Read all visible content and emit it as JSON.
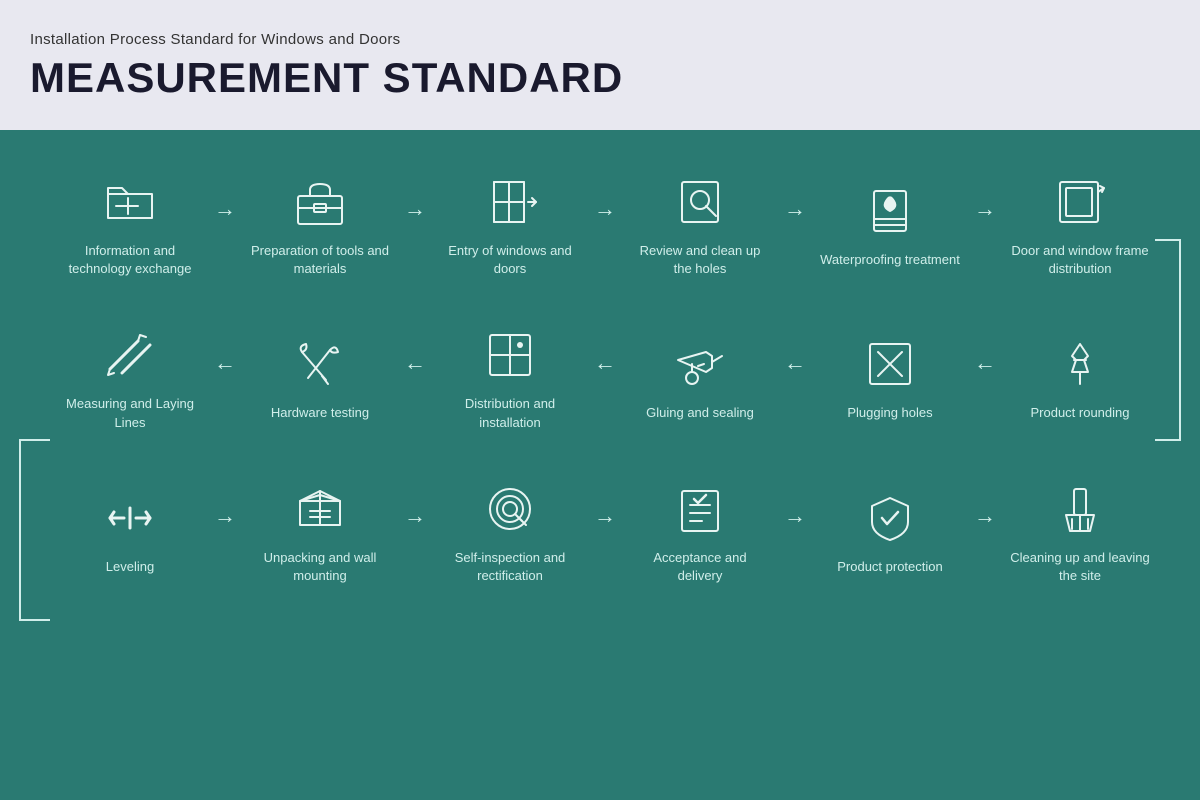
{
  "header": {
    "subtitle": "Installation Process Standard for Windows and Doors",
    "title": "MEASUREMENT STANDARD"
  },
  "colors": {
    "background": "#2a7a72",
    "header_bg": "#e8e8f0",
    "icon_stroke": "#e8f4f2",
    "text": "#d0eeea",
    "title": "#1a1a2e"
  },
  "row1": [
    {
      "id": "info-tech",
      "label": "Information and technology exchange"
    },
    {
      "id": "prep-tools",
      "label": "Preparation of tools and materials"
    },
    {
      "id": "entry-windows",
      "label": "Entry of windows and doors"
    },
    {
      "id": "review-holes",
      "label": "Review and clean up the holes"
    },
    {
      "id": "waterproofing",
      "label": "Waterproofing treatment"
    },
    {
      "id": "frame-dist",
      "label": "Door and window frame distribution"
    }
  ],
  "row2": [
    {
      "id": "measuring",
      "label": "Measuring and Laying Lines"
    },
    {
      "id": "hardware",
      "label": "Hardware testing"
    },
    {
      "id": "distribution",
      "label": "Distribution and installation"
    },
    {
      "id": "gluing",
      "label": "Gluing and sealing"
    },
    {
      "id": "plugging",
      "label": "Plugging holes"
    },
    {
      "id": "product-round",
      "label": "Product rounding"
    }
  ],
  "row3": [
    {
      "id": "leveling",
      "label": "Leveling"
    },
    {
      "id": "unpacking",
      "label": "Unpacking and wall mounting"
    },
    {
      "id": "self-inspect",
      "label": "Self-inspection and rectification"
    },
    {
      "id": "acceptance",
      "label": "Acceptance and delivery"
    },
    {
      "id": "protection",
      "label": "Product protection"
    },
    {
      "id": "cleanup",
      "label": "Cleaning up and leaving the site"
    }
  ]
}
